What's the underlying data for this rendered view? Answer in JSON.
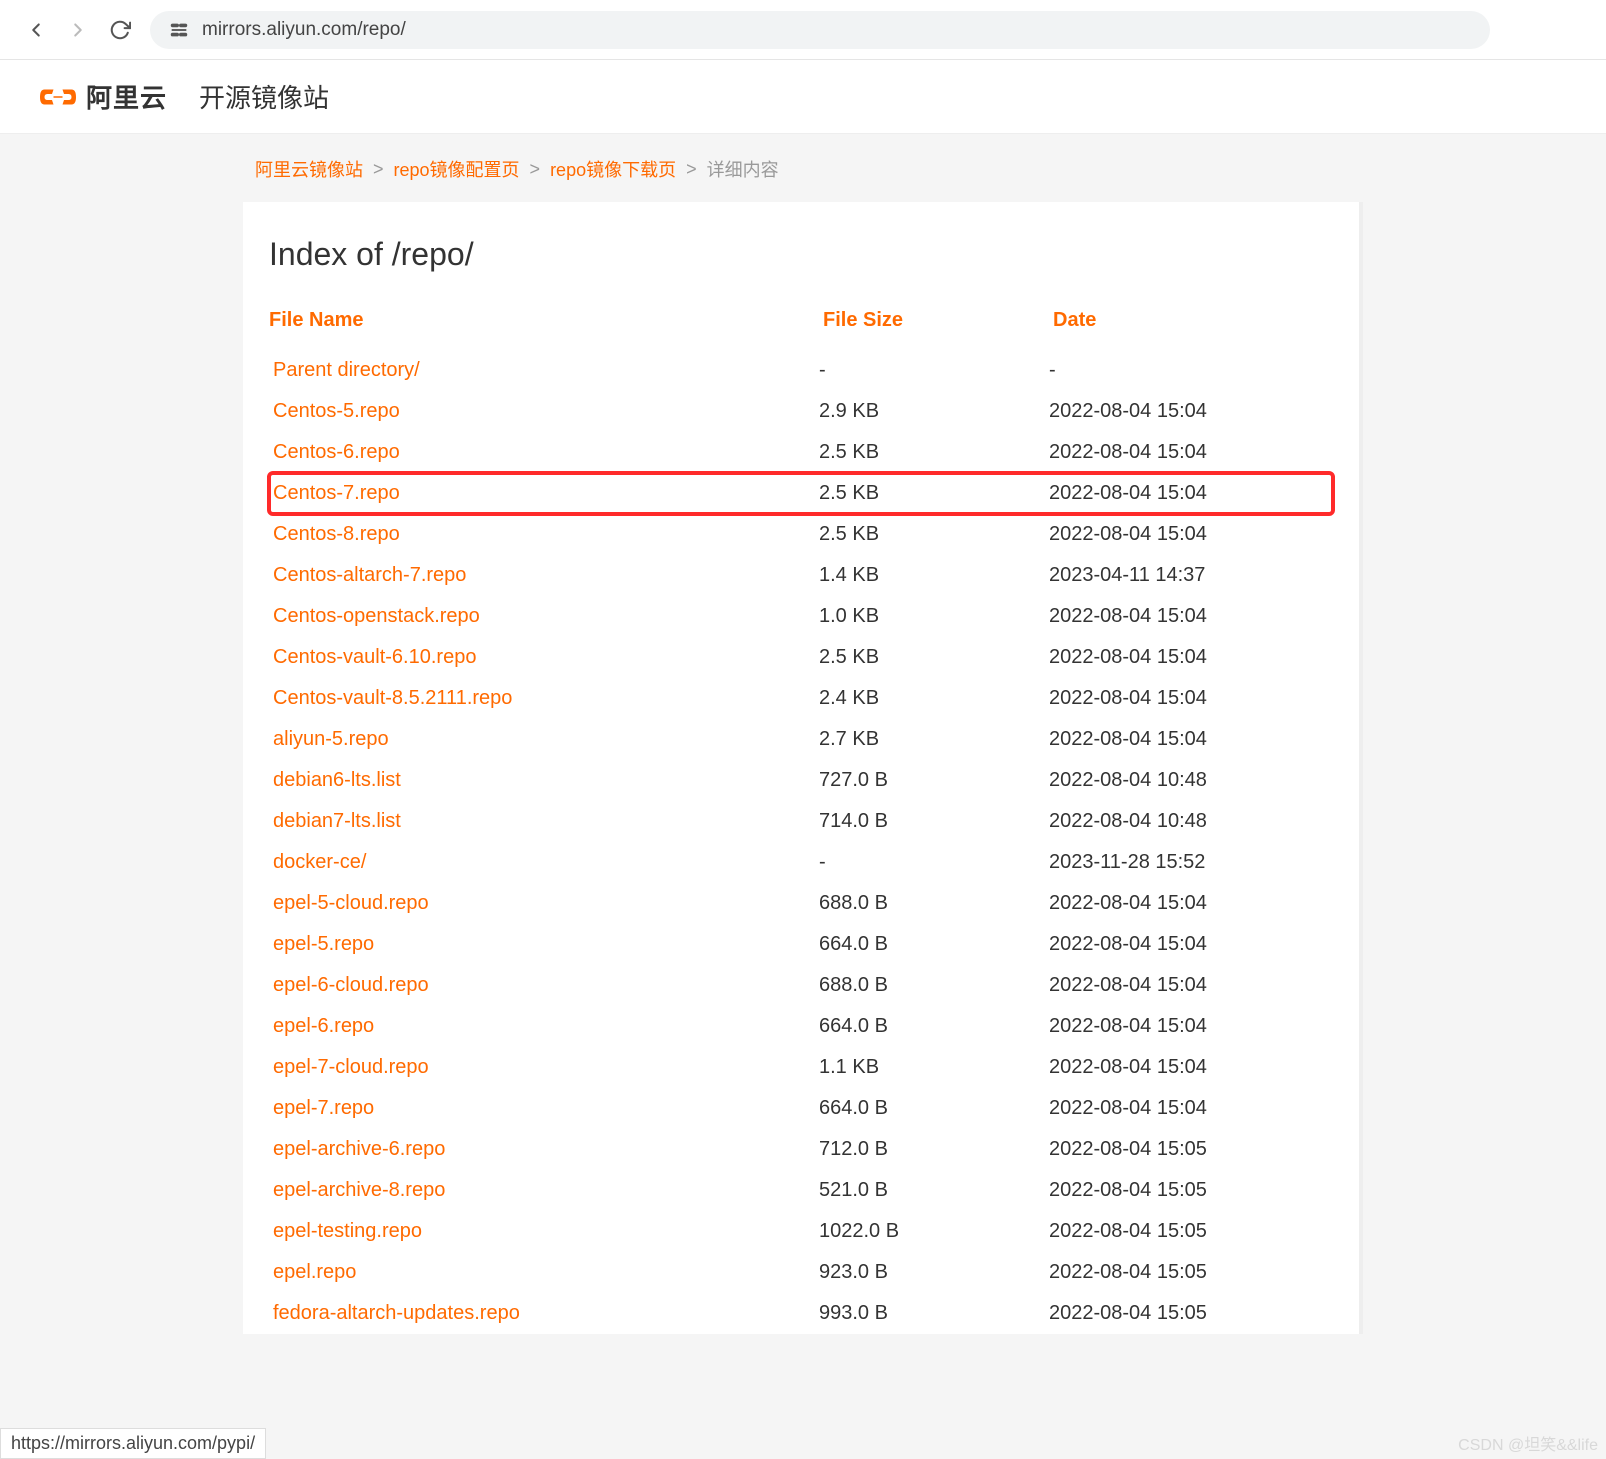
{
  "browser": {
    "url": "mirrors.aliyun.com/repo/"
  },
  "header": {
    "brand": "阿里云",
    "subtitle": "开源镜像站"
  },
  "breadcrumb": {
    "items": [
      {
        "label": "阿里云镜像站",
        "link": true
      },
      {
        "label": "repo镜像配置页",
        "link": true
      },
      {
        "label": "repo镜像下载页",
        "link": true
      },
      {
        "label": "详细内容",
        "link": false
      }
    ],
    "separator": ">"
  },
  "page": {
    "title": "Index of /repo/"
  },
  "columns": {
    "name": "File Name",
    "size": "File Size",
    "date": "Date"
  },
  "files": [
    {
      "name": "Parent directory/",
      "size": "-",
      "date": "-",
      "highlight": false
    },
    {
      "name": "Centos-5.repo",
      "size": "2.9 KB",
      "date": "2022-08-04 15:04",
      "highlight": false
    },
    {
      "name": "Centos-6.repo",
      "size": "2.5 KB",
      "date": "2022-08-04 15:04",
      "highlight": false
    },
    {
      "name": "Centos-7.repo",
      "size": "2.5 KB",
      "date": "2022-08-04 15:04",
      "highlight": true
    },
    {
      "name": "Centos-8.repo",
      "size": "2.5 KB",
      "date": "2022-08-04 15:04",
      "highlight": false
    },
    {
      "name": "Centos-altarch-7.repo",
      "size": "1.4 KB",
      "date": "2023-04-11 14:37",
      "highlight": false
    },
    {
      "name": "Centos-openstack.repo",
      "size": "1.0 KB",
      "date": "2022-08-04 15:04",
      "highlight": false
    },
    {
      "name": "Centos-vault-6.10.repo",
      "size": "2.5 KB",
      "date": "2022-08-04 15:04",
      "highlight": false
    },
    {
      "name": "Centos-vault-8.5.2111.repo",
      "size": "2.4 KB",
      "date": "2022-08-04 15:04",
      "highlight": false
    },
    {
      "name": "aliyun-5.repo",
      "size": "2.7 KB",
      "date": "2022-08-04 15:04",
      "highlight": false
    },
    {
      "name": "debian6-lts.list",
      "size": "727.0 B",
      "date": "2022-08-04 10:48",
      "highlight": false
    },
    {
      "name": "debian7-lts.list",
      "size": "714.0 B",
      "date": "2022-08-04 10:48",
      "highlight": false
    },
    {
      "name": "docker-ce/",
      "size": "-",
      "date": "2023-11-28 15:52",
      "highlight": false
    },
    {
      "name": "epel-5-cloud.repo",
      "size": "688.0 B",
      "date": "2022-08-04 15:04",
      "highlight": false
    },
    {
      "name": "epel-5.repo",
      "size": "664.0 B",
      "date": "2022-08-04 15:04",
      "highlight": false
    },
    {
      "name": "epel-6-cloud.repo",
      "size": "688.0 B",
      "date": "2022-08-04 15:04",
      "highlight": false
    },
    {
      "name": "epel-6.repo",
      "size": "664.0 B",
      "date": "2022-08-04 15:04",
      "highlight": false
    },
    {
      "name": "epel-7-cloud.repo",
      "size": "1.1 KB",
      "date": "2022-08-04 15:04",
      "highlight": false
    },
    {
      "name": "epel-7.repo",
      "size": "664.0 B",
      "date": "2022-08-04 15:04",
      "highlight": false
    },
    {
      "name": "epel-archive-6.repo",
      "size": "712.0 B",
      "date": "2022-08-04 15:05",
      "highlight": false
    },
    {
      "name": "epel-archive-8.repo",
      "size": "521.0 B",
      "date": "2022-08-04 15:05",
      "highlight": false
    },
    {
      "name": "epel-testing.repo",
      "size": "1022.0 B",
      "date": "2022-08-04 15:05",
      "highlight": false
    },
    {
      "name": "epel.repo",
      "size": "923.0 B",
      "date": "2022-08-04 15:05",
      "highlight": false
    },
    {
      "name": "fedora-altarch-updates.repo",
      "size": "993.0 B",
      "date": "2022-08-04 15:05",
      "highlight": false
    }
  ],
  "status_bar": "https://mirrors.aliyun.com/pypi/",
  "watermark": "CSDN @坦笑&&life"
}
